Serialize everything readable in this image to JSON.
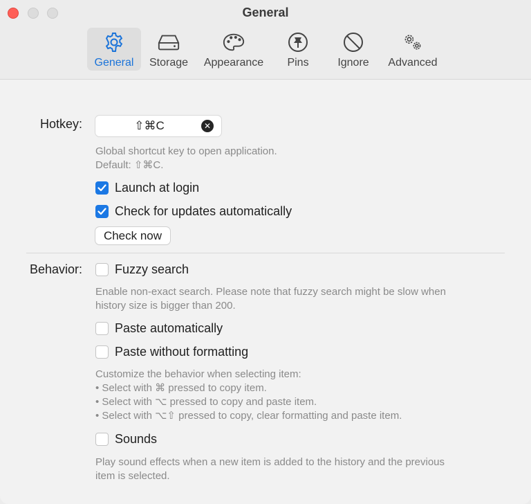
{
  "window": {
    "title": "General"
  },
  "toolbar": {
    "items": [
      {
        "label": "General",
        "icon": "gear-icon",
        "active": true
      },
      {
        "label": "Storage",
        "icon": "drive-icon"
      },
      {
        "label": "Appearance",
        "icon": "palette-icon"
      },
      {
        "label": "Pins",
        "icon": "pin-icon"
      },
      {
        "label": "Ignore",
        "icon": "prohibited-icon"
      },
      {
        "label": "Advanced",
        "icon": "gears-icon"
      }
    ]
  },
  "hotkey": {
    "label": "Hotkey:",
    "value": "⇧⌘C",
    "help_line1": "Global shortcut key to open application.",
    "help_line2": "Default: ⇧⌘C."
  },
  "launch_at_login": {
    "label": "Launch at login",
    "checked": true
  },
  "check_updates": {
    "label": "Check for updates automatically",
    "checked": true
  },
  "check_now": {
    "label": "Check now"
  },
  "behavior": {
    "label": "Behavior:",
    "fuzzy_search": {
      "label": "Fuzzy search",
      "checked": false
    },
    "fuzzy_help_line1": "Enable non-exact search. Please note that fuzzy search might be slow when",
    "fuzzy_help_line2": "history size is bigger than 200.",
    "paste_auto": {
      "label": "Paste automatically",
      "checked": false
    },
    "paste_plain": {
      "label": "Paste without formatting",
      "checked": false
    },
    "select_help_line1": "Customize the behavior when selecting item:",
    "select_help_line2": "• Select with ⌘ pressed to copy item.",
    "select_help_line3": "• Select with ⌥ pressed to copy and paste item.",
    "select_help_line4": "• Select with ⌥⇧ pressed to copy, clear formatting and paste item.",
    "sounds": {
      "label": "Sounds",
      "checked": false
    },
    "sounds_help_line1": "Play sound effects when a new item is added to the history and the previous",
    "sounds_help_line2": "item is selected."
  },
  "colors": {
    "accent": "#1b78e4",
    "close": "#fe5f57"
  }
}
